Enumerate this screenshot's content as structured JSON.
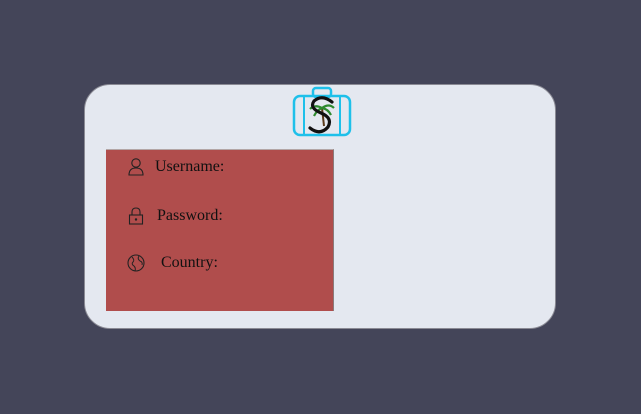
{
  "form": {
    "username_label": "Username:",
    "password_label": "Password:",
    "country_label": "Country:"
  },
  "icons": {
    "logo": "suitcase-palm-logo",
    "username": "user-icon",
    "password": "lock-icon",
    "country": "globe-icon"
  },
  "colors": {
    "page_background": "#444559",
    "card_background": "#e4e8f0",
    "form_panel": "#b04d4c",
    "logo_accent": "#1ec0ea",
    "logo_palm": "#2e8a2e"
  }
}
